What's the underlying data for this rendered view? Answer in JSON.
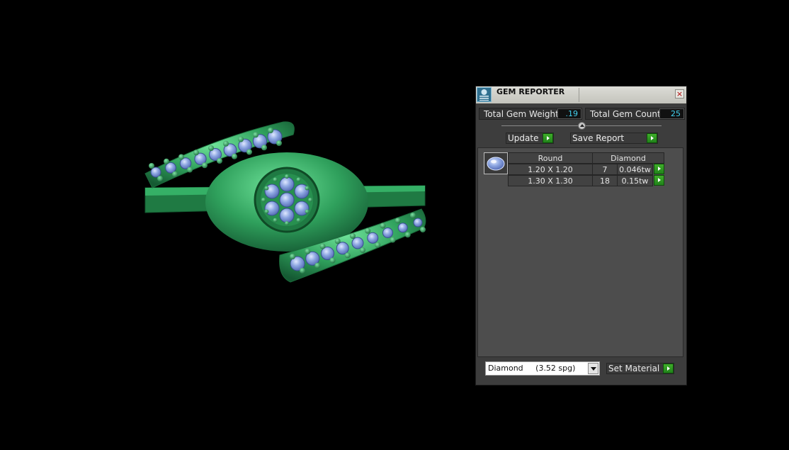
{
  "window": {
    "title": "GEM REPORTER",
    "close_glyph": "×"
  },
  "summary": {
    "weight_label": "Total Gem Weight",
    "weight_value": ".19",
    "count_label": "Total Gem Count",
    "count_value": "25"
  },
  "actions": {
    "update_label": "Update",
    "save_report_label": "Save Report"
  },
  "table": {
    "shape": "Round",
    "material": "Diamond",
    "rows": [
      {
        "size": "1.20 X 1.20",
        "count": "7",
        "weight": "0.046tw"
      },
      {
        "size": "1.30 X 1.30",
        "count": "18",
        "weight": "0.15tw"
      }
    ]
  },
  "material_select": {
    "value": "Diamond     (3.52 spg)",
    "button_label": "Set Material"
  },
  "colors": {
    "metal": "#2ea15c",
    "gem": "#7f98d8",
    "value_text": "#43d2f0",
    "play_button": "#2e9a22"
  },
  "icons": {
    "app": "gem-reporter-icon",
    "close": "close-icon",
    "collapse": "collapse-arrow-icon",
    "gem": "round-gem-icon",
    "play": "green-arrow-icon",
    "dropdown": "chevron-down-icon"
  }
}
